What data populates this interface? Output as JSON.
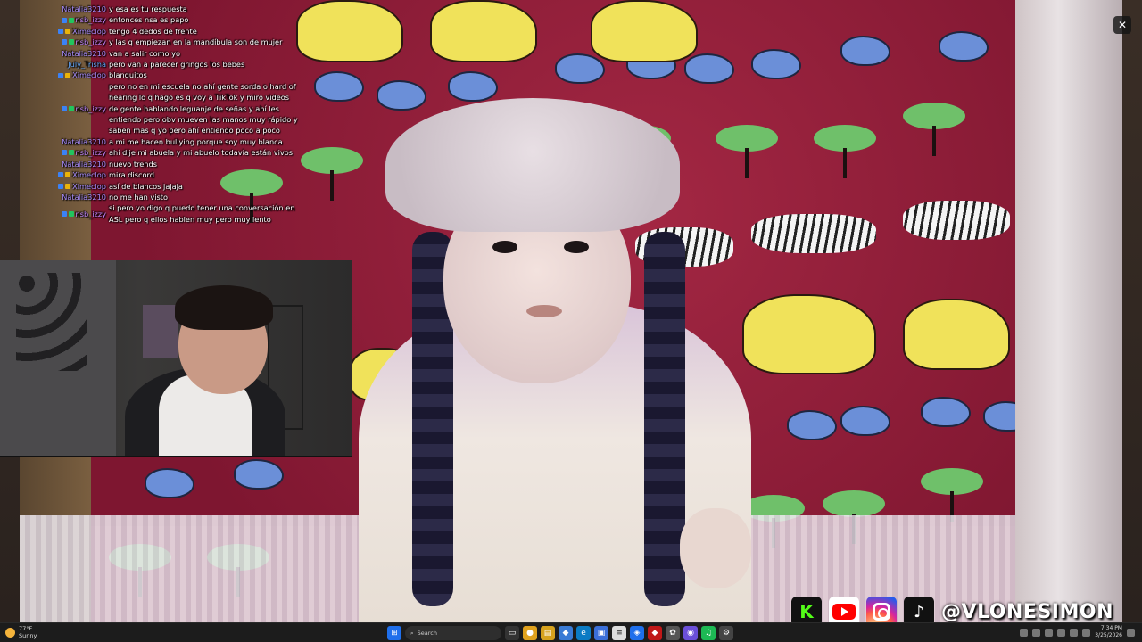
{
  "chat": [
    {
      "user": "Natalia3210",
      "color": "#a78bfa",
      "badges": [],
      "text": "y esa es tu respuesta"
    },
    {
      "user": "nsb_izzy",
      "color": "#c084fc",
      "badges": [
        "#3b82f6",
        "#22c55e"
      ],
      "text": "entonces nsa es papo"
    },
    {
      "user": "Ximeclop",
      "color": "#a78bfa",
      "badges": [
        "#3b82f6",
        "#eab308"
      ],
      "text": "tengo 4 dedos de frente"
    },
    {
      "user": "nsb_izzy",
      "color": "#c084fc",
      "badges": [
        "#3b82f6",
        "#22c55e"
      ],
      "text": "y las q empiezan en la mandíbula son de mujer"
    },
    {
      "user": "Natalia3210",
      "color": "#a78bfa",
      "badges": [],
      "text": "van a salir como yo"
    },
    {
      "user": "July_Trisha",
      "color": "#60a5fa",
      "badges": [],
      "text": "pero van a parecer gringos los bebes"
    },
    {
      "user": "Ximeclop",
      "color": "#a78bfa",
      "badges": [
        "#3b82f6",
        "#eab308"
      ],
      "text": "blanquitos"
    },
    {
      "user": "nsb_izzy",
      "color": "#c084fc",
      "badges": [
        "#3b82f6",
        "#22c55e"
      ],
      "text": "pero no en mi escuela no ahí gente sorda o hard of hearing lo q hago es q voy a TikTok y miro videos de gente hablando leguanje de señas y ahí les entiendo pero obv mueven las manos muy rápido y saben mas q yo pero ahí entiendo poco a poco"
    },
    {
      "user": "Natalia3210",
      "color": "#a78bfa",
      "badges": [],
      "text": "a mi me hacen bullying porque soy muy blanca"
    },
    {
      "user": "nsb_izzy",
      "color": "#c084fc",
      "badges": [
        "#3b82f6",
        "#22c55e"
      ],
      "text": "ahí dije mi abuela y mi abuelo todavía están vivos"
    },
    {
      "user": "Natalia3210",
      "color": "#a78bfa",
      "badges": [],
      "text": "nuevo trends"
    },
    {
      "user": "Ximeclop",
      "color": "#a78bfa",
      "badges": [
        "#3b82f6",
        "#eab308"
      ],
      "text": "mira discord"
    },
    {
      "user": "Ximeclop",
      "color": "#a78bfa",
      "badges": [
        "#3b82f6",
        "#eab308"
      ],
      "text": "así de blancos jajaja"
    },
    {
      "user": "Natalia3210",
      "color": "#a78bfa",
      "badges": [],
      "text": "no me han visto"
    },
    {
      "user": "nsb_izzy",
      "color": "#c084fc",
      "badges": [
        "#3b82f6",
        "#22c55e"
      ],
      "text": "si pero yo digo q puedo tener una conversación en ASL pero q ellos hablen muy pero muy lento"
    }
  ],
  "close_label": "✕",
  "socials": {
    "kick_label": "K",
    "tiktok_label": "♪",
    "handle": "@VLONESIMON"
  },
  "taskbar": {
    "weather_temp": "77°F",
    "weather_desc": "Sunny",
    "search_label": "Search",
    "time": "7:34 PM",
    "date": "3/25/2026"
  }
}
